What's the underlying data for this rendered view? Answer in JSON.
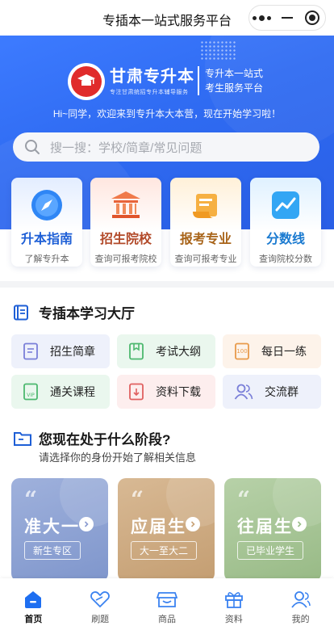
{
  "topbar": {
    "title": "专插本一站式服务平台"
  },
  "hero": {
    "brand_name": "甘肃专升本",
    "brand_slogan": "专注甘肃统招专升本辅导服务",
    "brand_right_line1": "专升本一站式",
    "brand_right_line2": "考生服务平台",
    "welcome": "Hi~同学，欢迎来到专升本大本营，现在开始学习啦！"
  },
  "search": {
    "placeholder": "搜一搜：学校/简章/常见问题"
  },
  "cards": [
    {
      "title": "升本指南",
      "subtitle": "了解专升本",
      "color": "#1e5fd6",
      "icon": "compass-icon"
    },
    {
      "title": "招生院校",
      "subtitle": "查询可报考院校",
      "color": "#b24a2a",
      "icon": "school-building-icon"
    },
    {
      "title": "报考专业",
      "subtitle": "查询可报考专业",
      "color": "#a8641a",
      "icon": "scroll-icon"
    },
    {
      "title": "分数线",
      "subtitle": "查询院校分数",
      "color": "#1a7ad0",
      "icon": "trend-chart-icon"
    }
  ],
  "study": {
    "title": "专插本学习大厅",
    "items": [
      {
        "label": "招生简章",
        "icon": "brochure-icon"
      },
      {
        "label": "考试大纲",
        "icon": "book-icon"
      },
      {
        "label": "每日一练",
        "icon": "practice-icon"
      },
      {
        "label": "通关课程",
        "icon": "vip-course-icon"
      },
      {
        "label": "资料下载",
        "icon": "download-doc-icon"
      },
      {
        "label": "交流群",
        "icon": "group-icon"
      }
    ]
  },
  "stage": {
    "title": "您现在处于什么阶段?",
    "subtitle": "请选择你的身份开始了解相关信息",
    "cards": [
      {
        "name": "准大一",
        "tag": "新生专区"
      },
      {
        "name": "应届生",
        "tag": "大一至大二"
      },
      {
        "name": "往届生",
        "tag": "已毕业学生"
      }
    ]
  },
  "tabbar": [
    {
      "label": "首页",
      "icon": "home-icon",
      "active": true
    },
    {
      "label": "刷题",
      "icon": "practice-heart-icon",
      "active": false
    },
    {
      "label": "商品",
      "icon": "shop-icon",
      "active": false
    },
    {
      "label": "资料",
      "icon": "gift-icon",
      "active": false
    },
    {
      "label": "我的",
      "icon": "profile-icon",
      "active": false
    }
  ],
  "colors": {
    "primary": "#2f6bf2",
    "tab_active": "#1e6ff1"
  }
}
